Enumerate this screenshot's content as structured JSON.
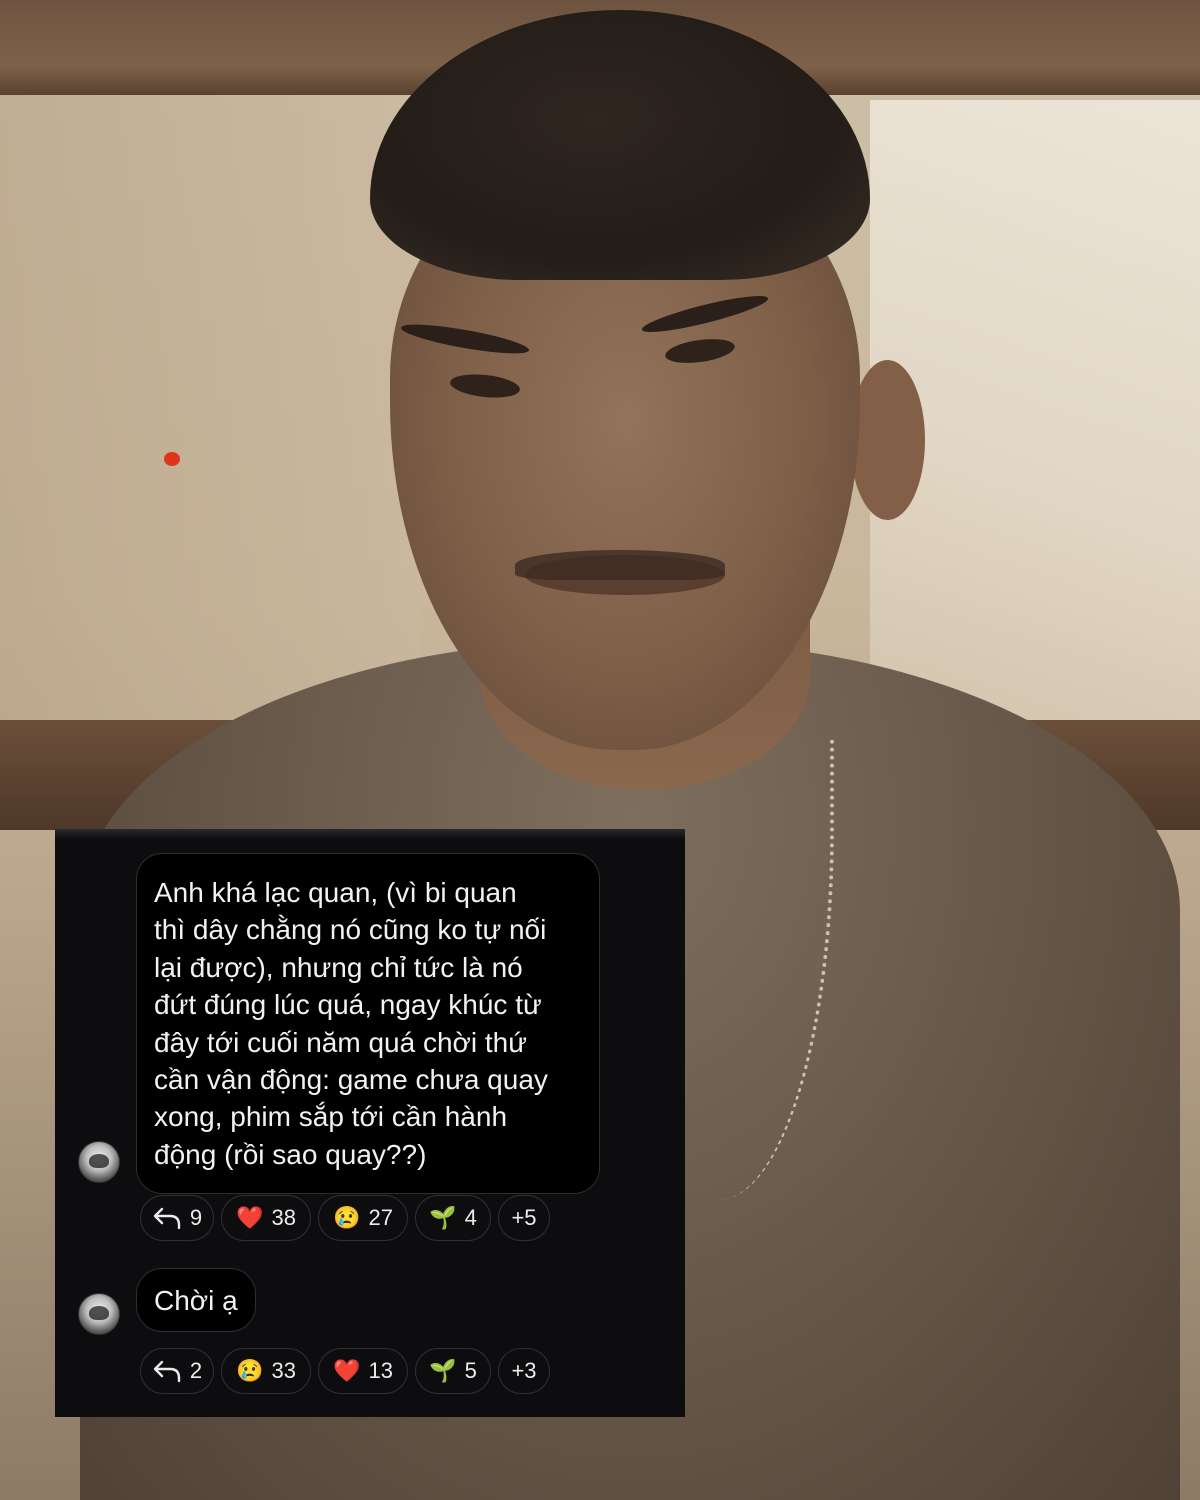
{
  "messages": [
    {
      "lines": [
        "Anh khá lạc quan, (vì bi quan",
        "thì dây chằng nó cũng ko tự nối",
        "lại được), nhưng chỉ tức là nó",
        "đứt đúng lúc quá, ngay khúc từ",
        "đây tới cuối năm quá chời thứ",
        "cần vận động: game chưa quay",
        "xong, phim sắp tới cần hành",
        "động (rồi sao quay??)"
      ],
      "reactions": {
        "reply_count": "9",
        "r1": {
          "icon": "red-heart-icon",
          "glyph": "❤️",
          "count": "38"
        },
        "r2": {
          "icon": "crying-face-icon",
          "glyph": "😢",
          "count": "27"
        },
        "r3": {
          "icon": "seedling-icon",
          "glyph": "🌱",
          "count": "4"
        },
        "more": "+5"
      }
    },
    {
      "text": "Chời ạ",
      "reactions": {
        "reply_count": "2",
        "r1": {
          "icon": "crying-face-icon",
          "glyph": "😢",
          "count": "33"
        },
        "r2": {
          "icon": "red-heart-icon",
          "glyph": "❤️",
          "count": "13"
        },
        "r3": {
          "icon": "seedling-icon",
          "glyph": "🌱",
          "count": "5"
        },
        "more": "+3"
      }
    }
  ],
  "colors": {
    "chat_background": "#0d0d10",
    "bubble_background": "#000000",
    "bubble_border": "#2e2e33",
    "text": "#f2f2f2"
  }
}
